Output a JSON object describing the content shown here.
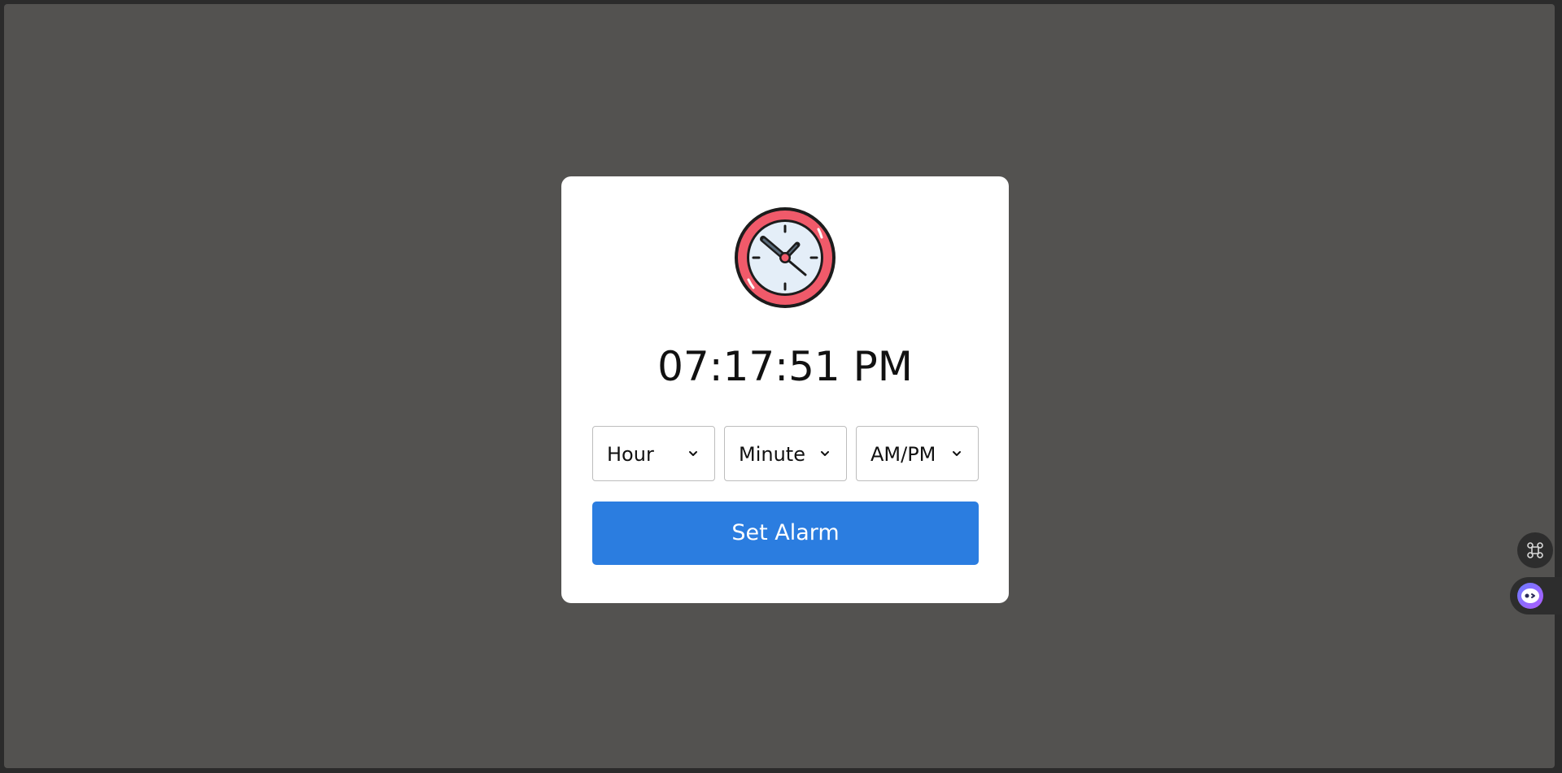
{
  "clock": {
    "time": "07:17:51 PM",
    "icon": "clock-icon"
  },
  "alarm_form": {
    "hour_select": {
      "label": "Hour"
    },
    "minute_select": {
      "label": "Minute"
    },
    "ampm_select": {
      "label": "AM/PM"
    },
    "set_button_label": "Set Alarm"
  },
  "floating_widgets": {
    "command_icon": "command-icon",
    "assistant_icon": "assistant-icon"
  },
  "colors": {
    "background": "#535250",
    "card": "#ffffff",
    "button": "#2b7de0",
    "clock_ring": "#f05a6a",
    "clock_face": "#e4eef8"
  }
}
